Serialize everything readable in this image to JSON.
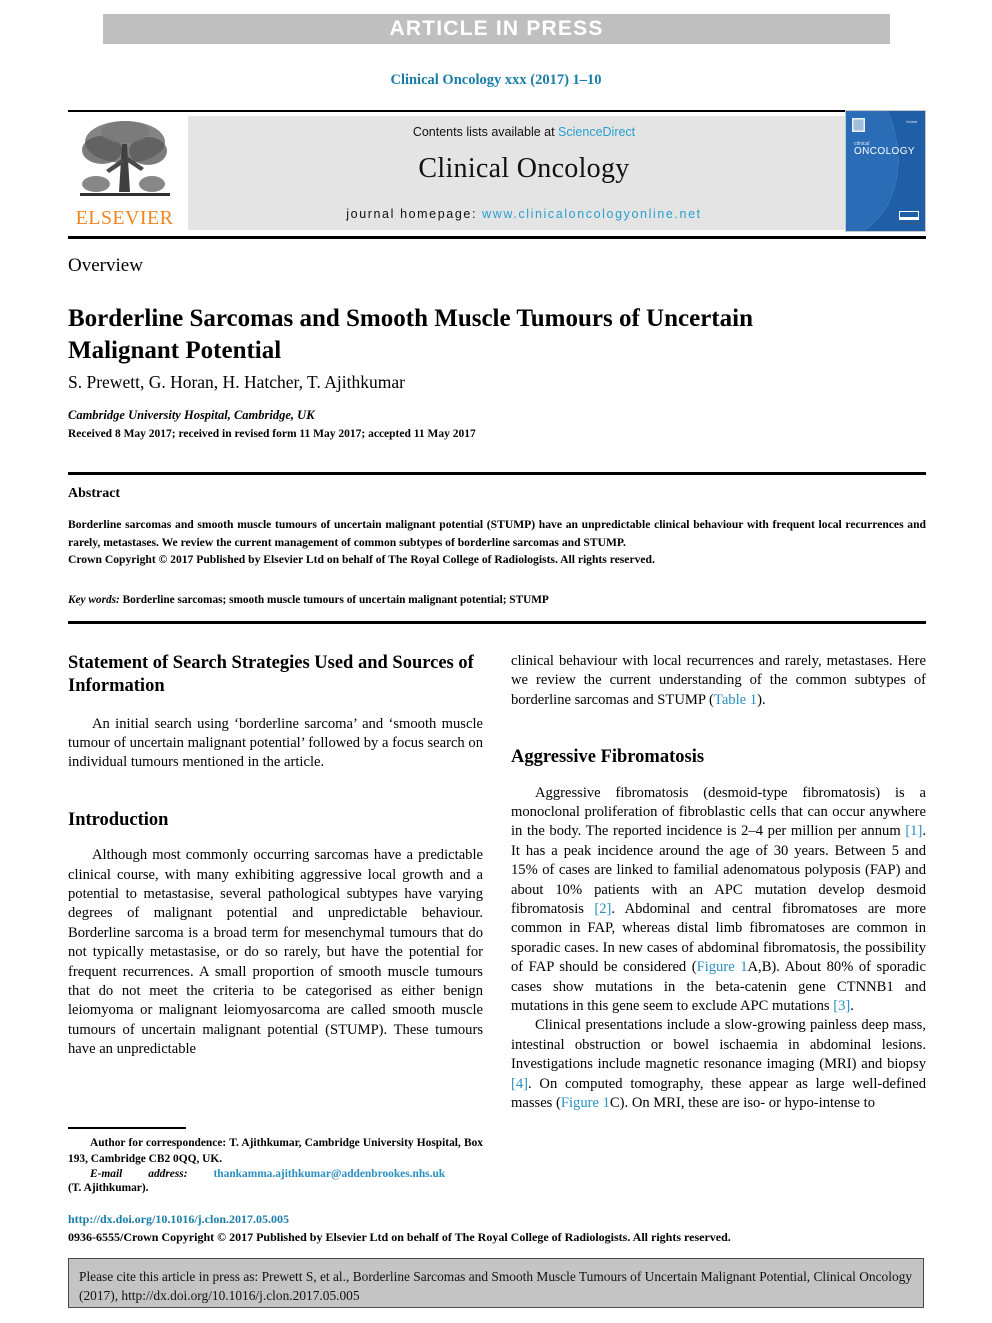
{
  "banner": {
    "text": "ARTICLE IN PRESS"
  },
  "running_head": "Clinical Oncology xxx (2017) 1–10",
  "masthead": {
    "publisher_wordmark": "ELSEVIER",
    "contents_prefix": "Contents lists available at ",
    "contents_link": "ScienceDirect",
    "journal_name": "Clinical Oncology",
    "homepage_prefix": "journal homepage: ",
    "homepage_url": "www.clinicaloncologyonline.net",
    "cover_title_line1": "clinical",
    "cover_title_line2": "ONCOLOGY"
  },
  "article": {
    "type": "Overview",
    "title": "Borderline Sarcomas and Smooth Muscle Tumours of Uncertain Malignant Potential",
    "authors": "S. Prewett, G. Horan, H. Hatcher, T. Ajithkumar",
    "affiliation": "Cambridge University Hospital, Cambridge, UK",
    "history": "Received 8 May 2017; received in revised form 11 May 2017; accepted 11 May 2017"
  },
  "abstract": {
    "heading": "Abstract",
    "body": "Borderline sarcomas and smooth muscle tumours of uncertain malignant potential (STUMP) have an unpredictable clinical behaviour with frequent local recurrences and rarely, metastases. We review the current management of common subtypes of borderline sarcomas and STUMP.",
    "copyright": "Crown Copyright © 2017 Published by Elsevier Ltd on behalf of The Royal College of Radiologists. All rights reserved.",
    "keywords_label": "Key words:",
    "keywords_value": " Borderline sarcomas; smooth muscle tumours of uncertain malignant potential; STUMP"
  },
  "left_column": {
    "search_heading": "Statement of Search Strategies Used and Sources of Information",
    "search_para": "An initial search using ‘borderline sarcoma’ and ‘smooth muscle tumour of uncertain malignant potential’ followed by a focus search on individual tumours mentioned in the article.",
    "intro_heading": "Introduction",
    "intro_para": "Although most commonly occurring sarcomas have a predictable clinical course, with many exhibiting aggressive local growth and a potential to metastasise, several pathological subtypes have varying degrees of malignant potential and unpredictable behaviour. Borderline sarcoma is a broad term for mesenchymal tumours that do not typically metastasise, or do so rarely, but have the potential for frequent recurrences. A small proportion of smooth muscle tumours that do not meet the criteria to be categorised as either benign leiomyoma or malignant leiomyosarcoma are called smooth muscle tumours of uncertain malignant potential (STUMP). These tumours have an unpredictable"
  },
  "right_column": {
    "continuation_pre": "clinical behaviour with local recurrences and rarely, metastases. Here we review the current understanding of the common subtypes of borderline sarcomas and STUMP (",
    "continuation_link": "Table 1",
    "continuation_post": ").",
    "fibromatosis_heading": "Aggressive Fibromatosis",
    "fib_p1_a": "Aggressive fibromatosis (desmoid-type fibromatosis) is a monoclonal proliferation of fibroblastic cells that can occur anywhere in the body. The reported incidence is 2–4 per million per annum ",
    "fib_p1_ref1": "[1]",
    "fib_p1_b": ". It has a peak incidence around the age of 30 years. Between 5 and 15% of cases are linked to familial adenomatous polyposis (FAP) and about 10% patients with an APC mutation develop desmoid fibromatosis ",
    "fib_p1_ref2": "[2]",
    "fib_p1_c": ". Abdominal and central fibromatoses are more common in FAP, whereas distal limb fibromatoses are common in sporadic cases. In new cases of abdominal fibromatosis, the possibility of FAP should be considered (",
    "fib_p1_fig1": "Figure 1",
    "fib_p1_d": "A,B). About 80% of sporadic cases show mutations in the beta-catenin gene CTNNB1 and mutations in this gene seem to exclude APC mutations ",
    "fib_p1_ref3": "[3]",
    "fib_p1_e": ".",
    "fib_p2_a": "Clinical presentations include a slow-growing painless deep mass, intestinal obstruction or bowel ischaemia in abdominal lesions. Investigations include magnetic resonance imaging (MRI) and biopsy ",
    "fib_p2_ref4": "[4]",
    "fib_p2_b": ". On computed tomography, these appear as large well-defined masses (",
    "fib_p2_fig1": "Figure 1",
    "fib_p2_c": "C). On MRI, these are iso- or hypo-intense to"
  },
  "footnote": {
    "correspondence": "Author for correspondence: T. Ajithkumar, Cambridge University Hospital, Box 193, Cambridge CB2 0QQ, UK.",
    "email_label": "E-mail",
    "email_word": "address:",
    "email_value": "thankamma.ajithkumar@addenbrookes.nhs.uk",
    "email_owner": "(T. Ajithkumar)."
  },
  "footer": {
    "doi": "http://dx.doi.org/10.1016/j.clon.2017.05.005",
    "copyright": "0936-6555/Crown Copyright © 2017 Published by Elsevier Ltd on behalf of The Royal College of Radiologists. All rights reserved.",
    "cite_text": "Please cite this article in press as: Prewett S, et al., Borderline Sarcomas and Smooth Muscle Tumours of Uncertain Malignant Potential, Clinical Oncology (2017), http://dx.doi.org/10.1016/j.clon.2017.05.005"
  },
  "colors": {
    "link": "#2a9fd0",
    "banner_bg": "#bfbfbf",
    "elsevier_orange": "#f08522",
    "cover_blue": "#1f5fa8"
  }
}
